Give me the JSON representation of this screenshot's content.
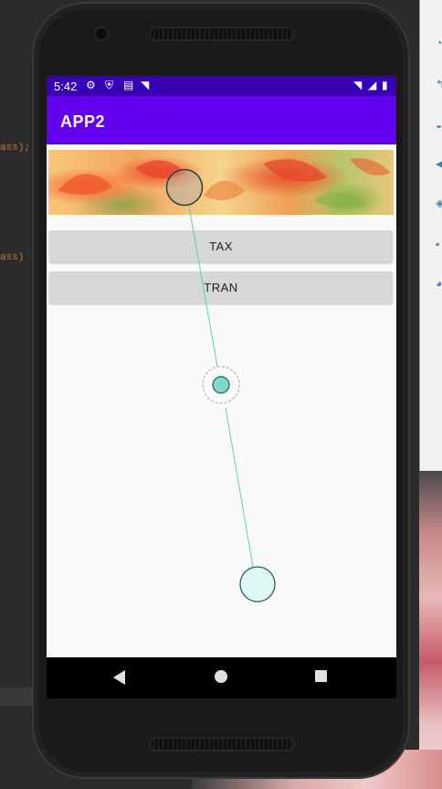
{
  "ide": {
    "code_line_1": "ass);",
    "code_line_2": "ass)"
  },
  "phone": {
    "status_bar": {
      "time": "5:42"
    },
    "app_bar": {
      "title": "APP2"
    },
    "buttons": {
      "tax_label": "TAX",
      "tran_label": "TRAN"
    },
    "navigation": {
      "back": "back",
      "home": "home",
      "recents": "recents"
    }
  },
  "colors": {
    "status_bar": "#3700b3",
    "app_bar": "#6200ee",
    "button": "#d6d7d7",
    "gesture_line": "#5ccfc3",
    "nav_bar": "#000000"
  },
  "icons": {
    "status": [
      "settings-icon",
      "shield-icon",
      "sim-card-icon",
      "wifi-icon",
      "signal-icon",
      "battery-icon"
    ],
    "nav": [
      "back-triangle-icon",
      "home-circle-icon",
      "recents-square-icon"
    ]
  }
}
